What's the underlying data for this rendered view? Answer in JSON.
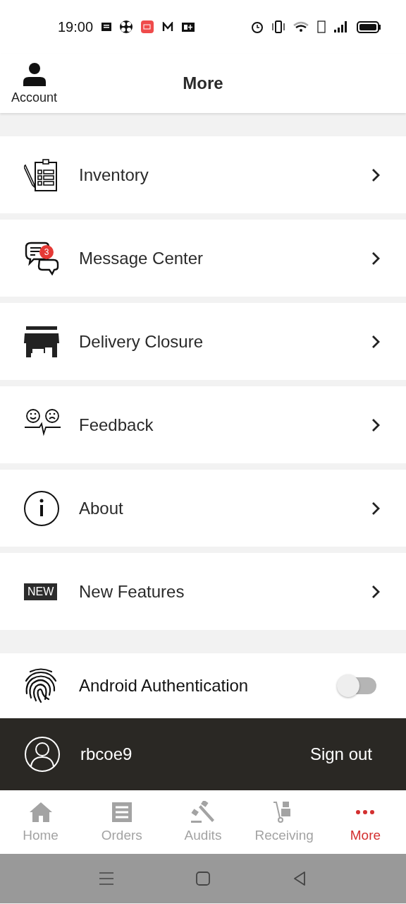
{
  "status_bar": {
    "time": "19:00"
  },
  "header": {
    "account_label": "Account",
    "title": "More"
  },
  "menu": [
    {
      "label": "Inventory"
    },
    {
      "label": "Message Center",
      "count": "3"
    },
    {
      "label": "Delivery Closure"
    },
    {
      "label": "Feedback"
    },
    {
      "label": "About"
    },
    {
      "label": "New Features",
      "tag": "NEW"
    }
  ],
  "auth": {
    "label": "Android Authentication",
    "on": false
  },
  "user_bar": {
    "username": "rbcoe9",
    "sign_out": "Sign out"
  },
  "tab_bar": [
    {
      "label": "Home",
      "selected": false
    },
    {
      "label": "Orders",
      "selected": false
    },
    {
      "label": "Audits",
      "selected": false
    },
    {
      "label": "Receiving",
      "selected": false
    },
    {
      "label": "More",
      "selected": true
    }
  ]
}
